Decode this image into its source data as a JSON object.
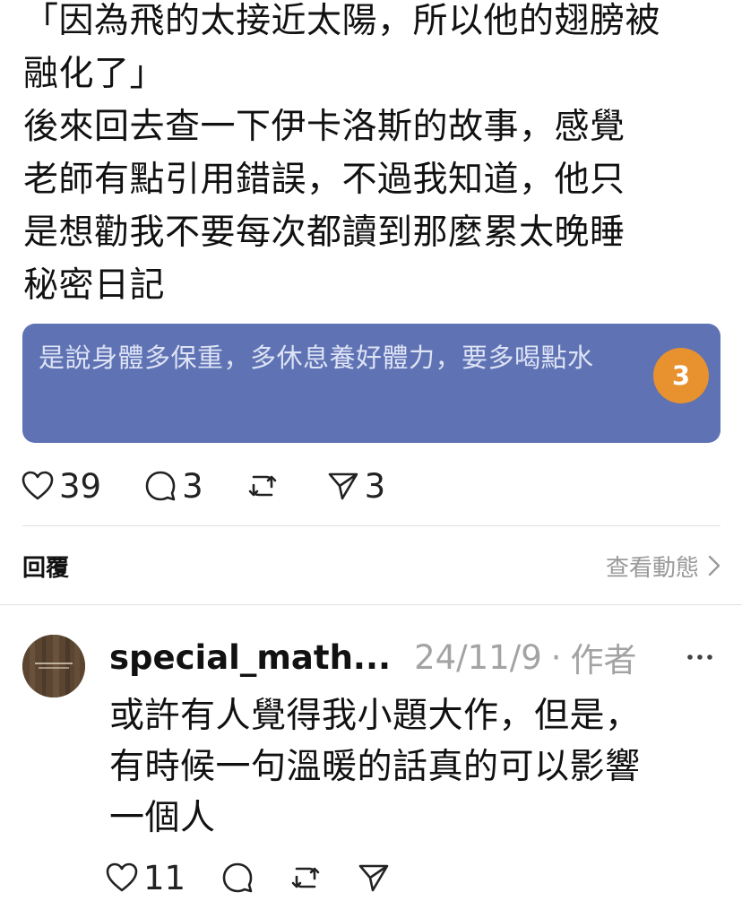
{
  "post": {
    "body": "「因為飛的太接近太陽，所以他的翅膀被\n融化了」\n後來回去查一下伊卡洛斯的故事，感覺\n老師有點引用錯誤，不過我知道，他只\n是想勸我不要每次都讀到那麼累太晚睡\n秘密日記",
    "quote_card": {
      "text": "是說身體多保重，多休息養好體力，要多喝點水",
      "badge": "3",
      "bg_color": "#5f72b3",
      "badge_color": "#e8912f"
    },
    "actions": {
      "likes": "39",
      "comments": "3",
      "reposts": "",
      "shares": "3"
    }
  },
  "replies_bar": {
    "label": "回覆",
    "activity_link": "查看動態"
  },
  "comment": {
    "username": "special_math...",
    "date": "24/11/9",
    "separator": "·",
    "author_tag": "作者",
    "body": "或許有人覺得我小題大作，但是，\n有時候一句溫暖的話真的可以影響\n一個人",
    "actions": {
      "likes": "11"
    }
  },
  "icons": {
    "like": "heart-icon",
    "comment": "comment-bubble-icon",
    "repost": "repost-icon",
    "share": "send-icon",
    "more": "more-dots-icon",
    "chevron": "chevron-right-icon"
  }
}
